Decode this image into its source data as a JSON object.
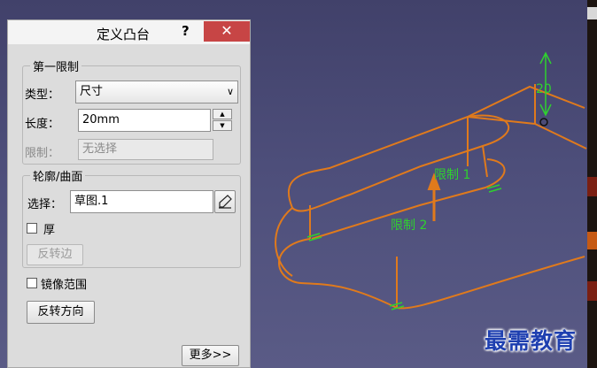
{
  "dialog": {
    "title": "定义凸台",
    "help": "?",
    "close": "✕",
    "first_limit": {
      "group_title": "第一限制",
      "type_label": "类型：",
      "type_value": "尺寸",
      "length_label": "长度：",
      "length_value": "20mm",
      "limit_label": "限制：",
      "limit_value": "无选择"
    },
    "profile": {
      "group_title": "轮廓/曲面",
      "selection_label": "选择：",
      "selection_value": "草图.1",
      "thick_label": "厚",
      "reverse_side_label": "反转边"
    },
    "mirror_label": "镜像范围",
    "reverse_direction_label": "反转方向",
    "more_label": "更多>>"
  },
  "viewport": {
    "limit1_label": "限制 1",
    "limit2_label": "限制 2",
    "dimension_label": "20"
  },
  "watermark": "最需教育",
  "colors": {
    "sketch": "#e07a1c",
    "annotation": "#2fd12f",
    "close_button": "#c74545"
  }
}
